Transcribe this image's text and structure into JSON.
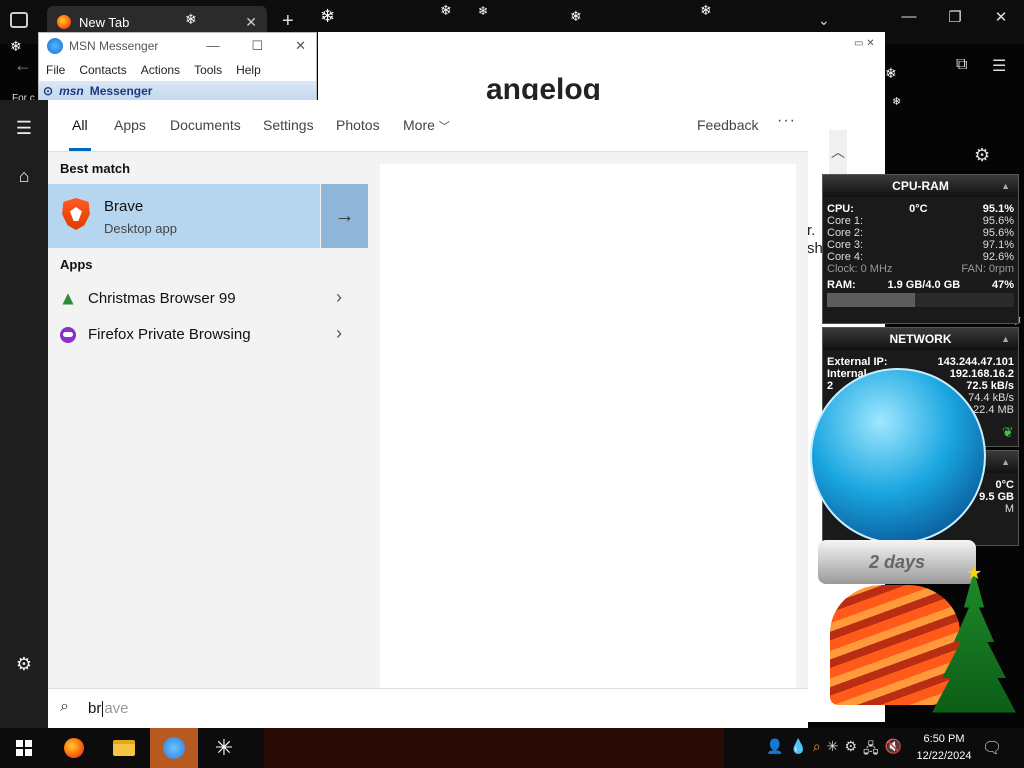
{
  "browser": {
    "tab_title": "New Tab",
    "page_title_partial": "angelog",
    "page_snippet": "r.\nsh",
    "left_snippet": "For c"
  },
  "msn": {
    "title": "MSN Messenger",
    "menu": [
      "File",
      "Contacts",
      "Actions",
      "Tools",
      "Help"
    ],
    "brand": "msn",
    "strip_label": "Messenger"
  },
  "search": {
    "tabs": [
      "All",
      "Apps",
      "Documents",
      "Settings",
      "Photos",
      "More"
    ],
    "active_tab": "All",
    "feedback": "Feedback",
    "best_match_heading": "Best match",
    "best_match": {
      "name": "Brave",
      "subtitle": "Desktop app"
    },
    "apps_heading": "Apps",
    "apps": [
      {
        "label": "Christmas Browser 99",
        "icon": "tree-icon"
      },
      {
        "label": "Firefox Private Browsing",
        "icon": "private-mask-icon"
      }
    ],
    "query_typed": "br",
    "query_suggestion": "ave"
  },
  "gadget_cpu": {
    "title": "CPU-RAM",
    "cpu_label": "CPU:",
    "cpu_temp": "0°C",
    "cpu_pct": "95.1%",
    "cores": [
      {
        "label": "Core 1:",
        "value": "95.6%"
      },
      {
        "label": "Core 2:",
        "value": "95.6%"
      },
      {
        "label": "Core 3:",
        "value": "97.1%"
      },
      {
        "label": "Core 4:",
        "value": "92.6%"
      }
    ],
    "clock": "Clock: 0 MHz",
    "fan": "FAN: 0rpm",
    "ram_label": "RAM:",
    "ram_value": "1.9 GB/4.0 GB",
    "ram_pct": "47%",
    "ram_fraction": 0.47
  },
  "gadget_network": {
    "title": "NETWORK",
    "rows": [
      {
        "label": "External IP:",
        "value": "143.244.47.101"
      },
      {
        "label": "Internal",
        "value": "192.168.16.2"
      },
      {
        "label": "2",
        "value": "72.5 kB/s"
      },
      {
        "label": "",
        "value": "74.4 kB/s"
      },
      {
        "label": "",
        "value": "22.4 MB"
      }
    ]
  },
  "gadget_third": {
    "temp": "0°C",
    "size": "9.5 GB",
    "letter": "M"
  },
  "countdown": {
    "text": "2 days"
  },
  "taskbar": {
    "time": "6:50 PM",
    "date": "12/22/2024"
  }
}
